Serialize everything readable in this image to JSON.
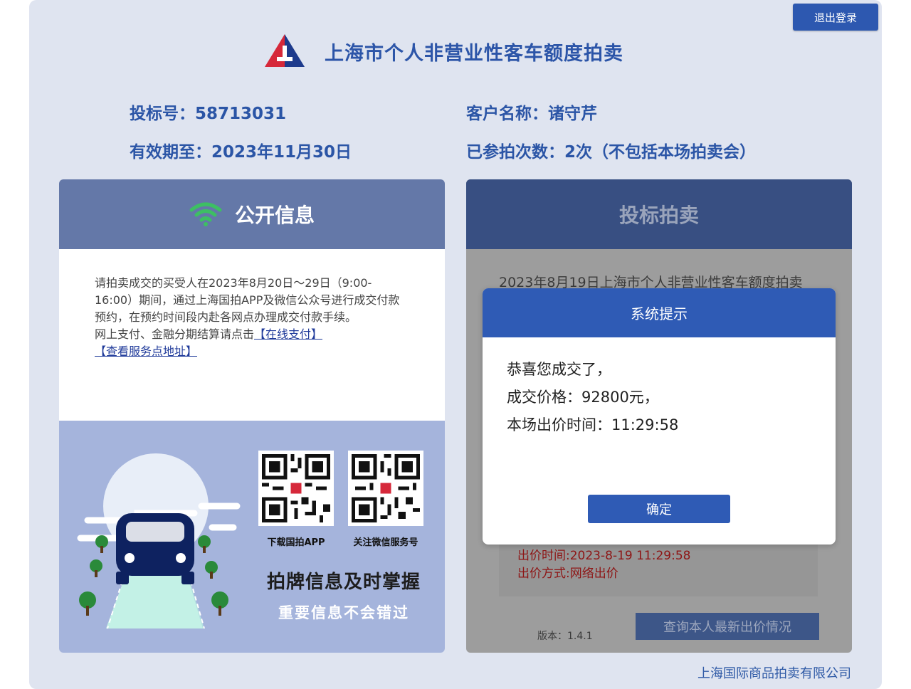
{
  "header": {
    "logout_label": "退出登录",
    "title": "上海市个人非营业性客车额度拍卖"
  },
  "user": {
    "bid_no_label": "投标号：",
    "bid_no": "58713031",
    "customer_label": "客户名称：",
    "customer_name": "诸守芹",
    "valid_label": "有效期至：",
    "valid_until": "2023年11月30日",
    "count_label": "已参拍次数：",
    "count_value": "2次（不包括本场拍卖会）"
  },
  "public_info": {
    "title": "公开信息",
    "paragraph": "请拍卖成交的买受人在2023年8月20日～29日（9:00-16:00）期间，通过上海国拍APP及微信公众号进行成交付款预约，在预约时间段内赴各网点办理成交付款手续。",
    "pay_text": "网上支付、金融分期结算请点击",
    "link_pay": "【在线支付】",
    "link_service": "【查看服务点地址】",
    "qr_app_caption": "下载国拍APP",
    "qr_wechat_caption": "关注微信服务号",
    "slogan_main": "拍牌信息及时掌握",
    "slogan_sub": "重要信息不会错过"
  },
  "bidding": {
    "title": "投标拍卖",
    "auction_name": "2023年8月19日上海市个人非营业性客车额度拍卖",
    "bid_time": "出价时间:2023-8-19 11:29:58",
    "bid_method": "出价方式:网络出价",
    "version": "版本：1.4.1",
    "query_label": "查询本人最新出价情况"
  },
  "dialog": {
    "title": "系统提示",
    "line1": "恭喜您成交了，",
    "line2": "成交价格：92800元，",
    "line3": "本场出价时间：11:29:58",
    "ok_label": "确定"
  },
  "footer": {
    "company": "上海国际商品拍卖有限公司"
  },
  "colors": {
    "brand_blue": "#2d58b0",
    "panel_header": "#6478a8",
    "wifi_green": "#3dbf63"
  }
}
